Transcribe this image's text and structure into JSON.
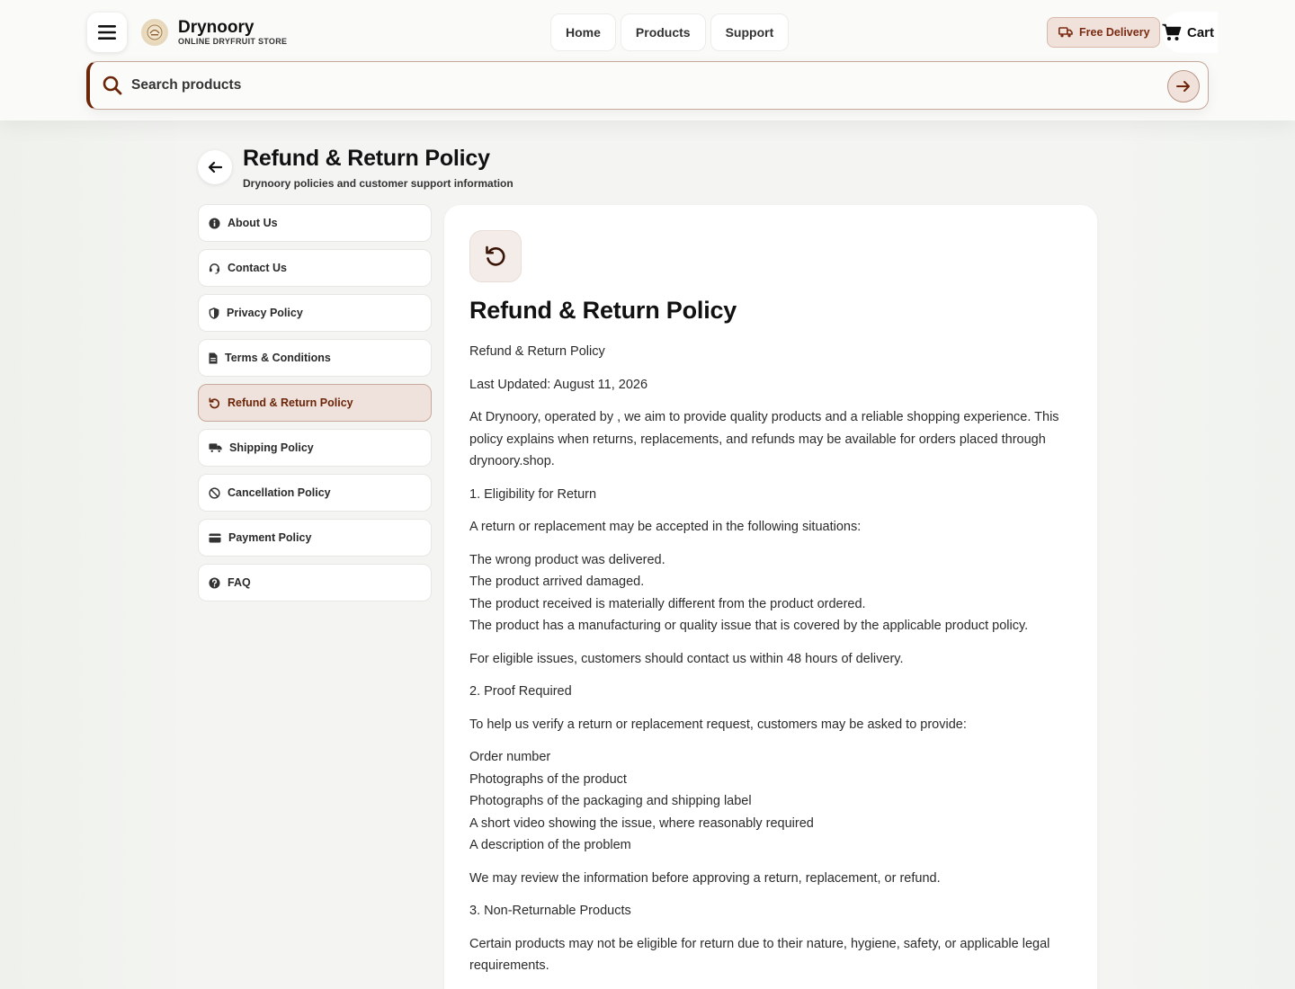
{
  "header": {
    "brand_name": "Drynoory",
    "brand_tagline": "ONLINE DRYFRUIT STORE",
    "nav": [
      "Home",
      "Products",
      "Support"
    ],
    "delivery_label": "Free Delivery",
    "cart_label": "Cart",
    "search_placeholder": "Search products"
  },
  "page": {
    "title": "Refund & Return Policy",
    "subtitle": "Drynoory policies and customer support information"
  },
  "sidebar": {
    "items": [
      {
        "label": "About Us",
        "icon": "info-icon"
      },
      {
        "label": "Contact Us",
        "icon": "headset-icon"
      },
      {
        "label": "Privacy Policy",
        "icon": "shield-icon"
      },
      {
        "label": "Terms & Conditions",
        "icon": "document-icon"
      },
      {
        "label": "Refund & Return Policy",
        "icon": "undo-icon",
        "active": true
      },
      {
        "label": "Shipping Policy",
        "icon": "truck-icon"
      },
      {
        "label": "Cancellation Policy",
        "icon": "ban-icon"
      },
      {
        "label": "Payment Policy",
        "icon": "credit-card-icon"
      },
      {
        "label": "FAQ",
        "icon": "question-icon"
      }
    ]
  },
  "content": {
    "title": "Refund & Return Policy",
    "paragraphs": [
      "Refund & Return Policy",
      "Last Updated: August 11, 2026",
      "At Drynoory, operated by , we aim to provide quality products and a reliable shopping experience. This policy explains when returns, replacements, and refunds may be available for orders placed through drynoory.shop.",
      "1. Eligibility for Return",
      "A return or replacement may be accepted in the following situations:",
      "The wrong product was delivered.",
      "The product arrived damaged.",
      "The product received is materially different from the product ordered.",
      "The product has a manufacturing or quality issue that is covered by the applicable product policy.",
      "For eligible issues, customers should contact us within 48 hours of delivery.",
      "2. Proof Required",
      "To help us verify a return or replacement request, customers may be asked to provide:",
      "Order number",
      "Photographs of the product",
      "Photographs of the packaging and shipping label",
      "A short video showing the issue, where reasonably required",
      "A description of the problem",
      "We may review the information before approving a return, replacement, or refund.",
      "3. Non-Returnable Products",
      "Certain products may not be eligible for return due to their nature, hygiene, safety, or applicable legal requirements."
    ]
  },
  "colors": {
    "accent": "#6b2508",
    "accent_soft": "#efe1dc"
  }
}
